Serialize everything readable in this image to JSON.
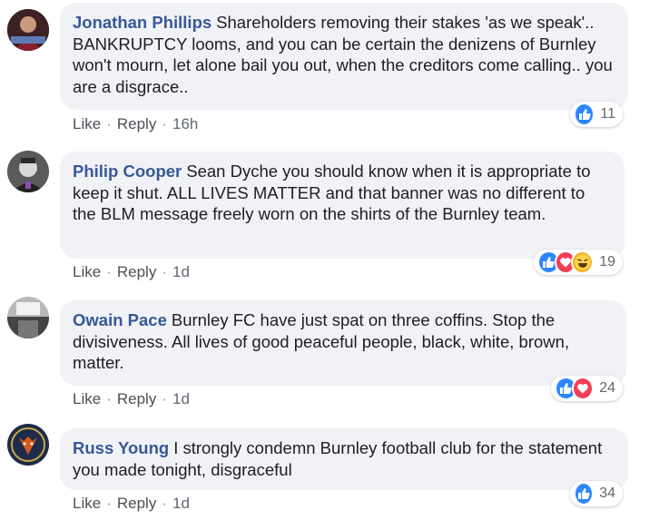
{
  "comments": [
    {
      "author": "Jonathan Phillips",
      "text": "Shareholders removing their stakes 'as we speak'.. BANKRUPTCY looms, and you can be certain the denizens of Burnley won't mourn, let alone bail you out, when the creditors come calling.. you are a disgrace..",
      "like_label": "Like",
      "reply_label": "Reply",
      "time": "16h",
      "reactions": [
        "like"
      ],
      "reaction_count": "11",
      "avatar_color": "#7a3b3b"
    },
    {
      "author": "Philip Cooper",
      "text": "Sean Dyche you should know when it is appropriate to keep it shut. ALL LIVES MATTER and that banner was no different to the BLM message freely worn on the shirts of the Burnley team.",
      "like_label": "Like",
      "reply_label": "Reply",
      "time": "1d",
      "reactions": [
        "like",
        "love",
        "haha"
      ],
      "reaction_count": "19",
      "avatar_color": "#6b6b6b"
    },
    {
      "author": "Owain Pace",
      "text": "Burnley FC have just spat on three coffins. Stop the divisiveness. All lives of good peaceful people, black, white, brown, matter.",
      "like_label": "Like",
      "reply_label": "Reply",
      "time": "1d",
      "reactions": [
        "like",
        "love"
      ],
      "reaction_count": "24",
      "avatar_color": "#9a9a9a"
    },
    {
      "author": "Russ Young",
      "text": "I strongly condemn Burnley football club for the statement you made tonight, disgraceful",
      "like_label": "Like",
      "reply_label": "Reply",
      "time": "1d",
      "reactions": [
        "like"
      ],
      "reaction_count": "34",
      "avatar_color": "#2a3a5a"
    }
  ],
  "separator": "·",
  "colors": {
    "author": "#385898",
    "bubble": "#f0f2f5",
    "like": "#2d86ff",
    "love": "#f33e58",
    "haha": "#f7b125"
  }
}
